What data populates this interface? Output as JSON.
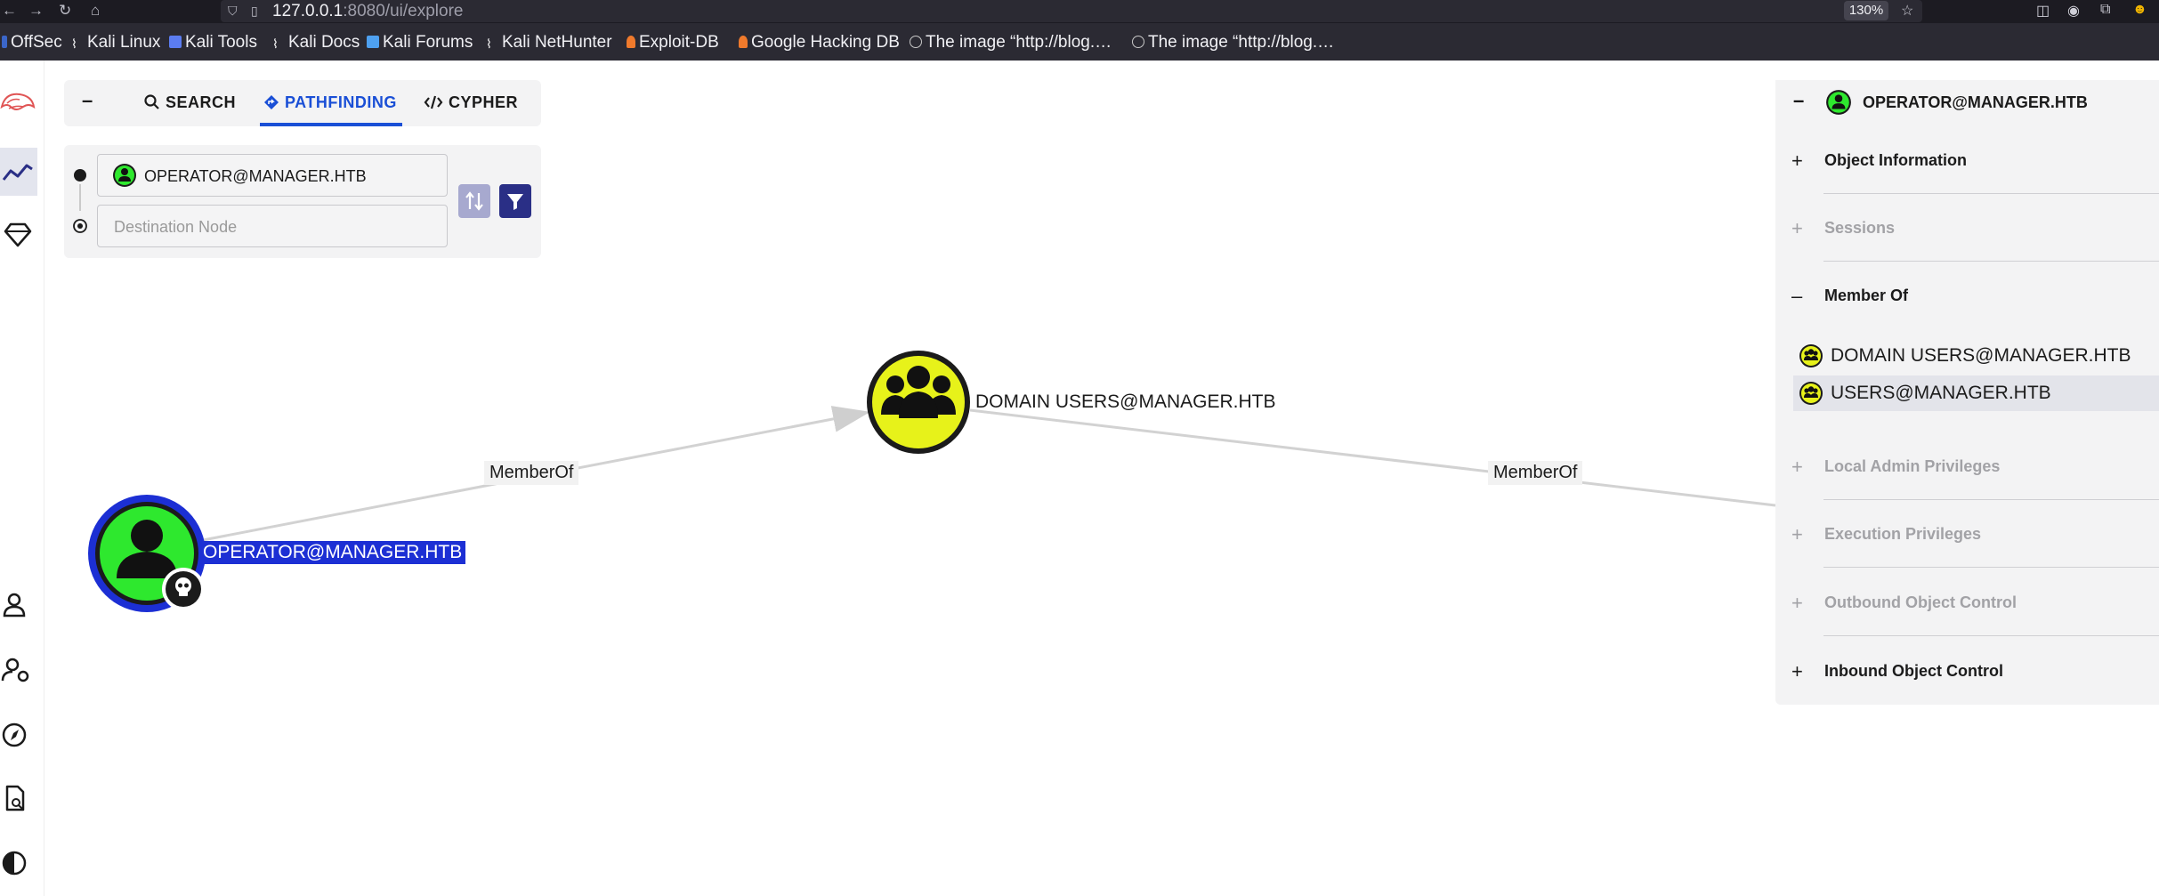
{
  "browser": {
    "url_host": "127.0.0.1",
    "url_rest": ":8080/ui/explore",
    "zoom": "130%"
  },
  "bookmarks": [
    {
      "label": "OffSec",
      "color": "#3b66c9"
    },
    {
      "label": "Kali Linux",
      "color": "#ffffff"
    },
    {
      "label": "Kali Tools",
      "color": "#5b7cf0"
    },
    {
      "label": "Kali Docs",
      "color": "#ffffff"
    },
    {
      "label": "Kali Forums",
      "color": "#4ea0f0"
    },
    {
      "label": "Kali NetHunter",
      "color": "#ffffff"
    },
    {
      "label": "Exploit-DB",
      "color": "#f07a2c"
    },
    {
      "label": "Google Hacking DB",
      "color": "#f07a2c"
    },
    {
      "label": "The image “http://blog.…",
      "color": "#c8c8c8"
    },
    {
      "label": "The image “http://blog.…",
      "color": "#c8c8c8"
    }
  ],
  "tabs": {
    "search": "SEARCH",
    "pathfinding": "PATHFINDING",
    "cypher": "CYPHER"
  },
  "pathfinding": {
    "start_node": "OPERATOR@MANAGER.HTB",
    "destination_placeholder": "Destination Node"
  },
  "graph": {
    "nodes": {
      "user": "OPERATOR@MANAGER.HTB",
      "group": "DOMAIN USERS@MANAGER.HTB"
    },
    "edges": {
      "edge1": "MemberOf",
      "edge2": "MemberOf"
    },
    "colors": {
      "user_node": "#2ee82e",
      "group_node": "#e7f21a",
      "selection": "#1c2fd4"
    }
  },
  "right_panel": {
    "title": "OPERATOR@MANAGER.HTB",
    "sections": {
      "object_information": "Object Information",
      "sessions": "Sessions",
      "member_of": "Member Of",
      "local_admin": "Local Admin Privileges",
      "execution": "Execution Privileges",
      "outbound": "Outbound Object Control",
      "inbound": "Inbound Object Control"
    },
    "member_of_items": [
      "DOMAIN USERS@MANAGER.HTB",
      "USERS@MANAGER.HTB"
    ]
  }
}
